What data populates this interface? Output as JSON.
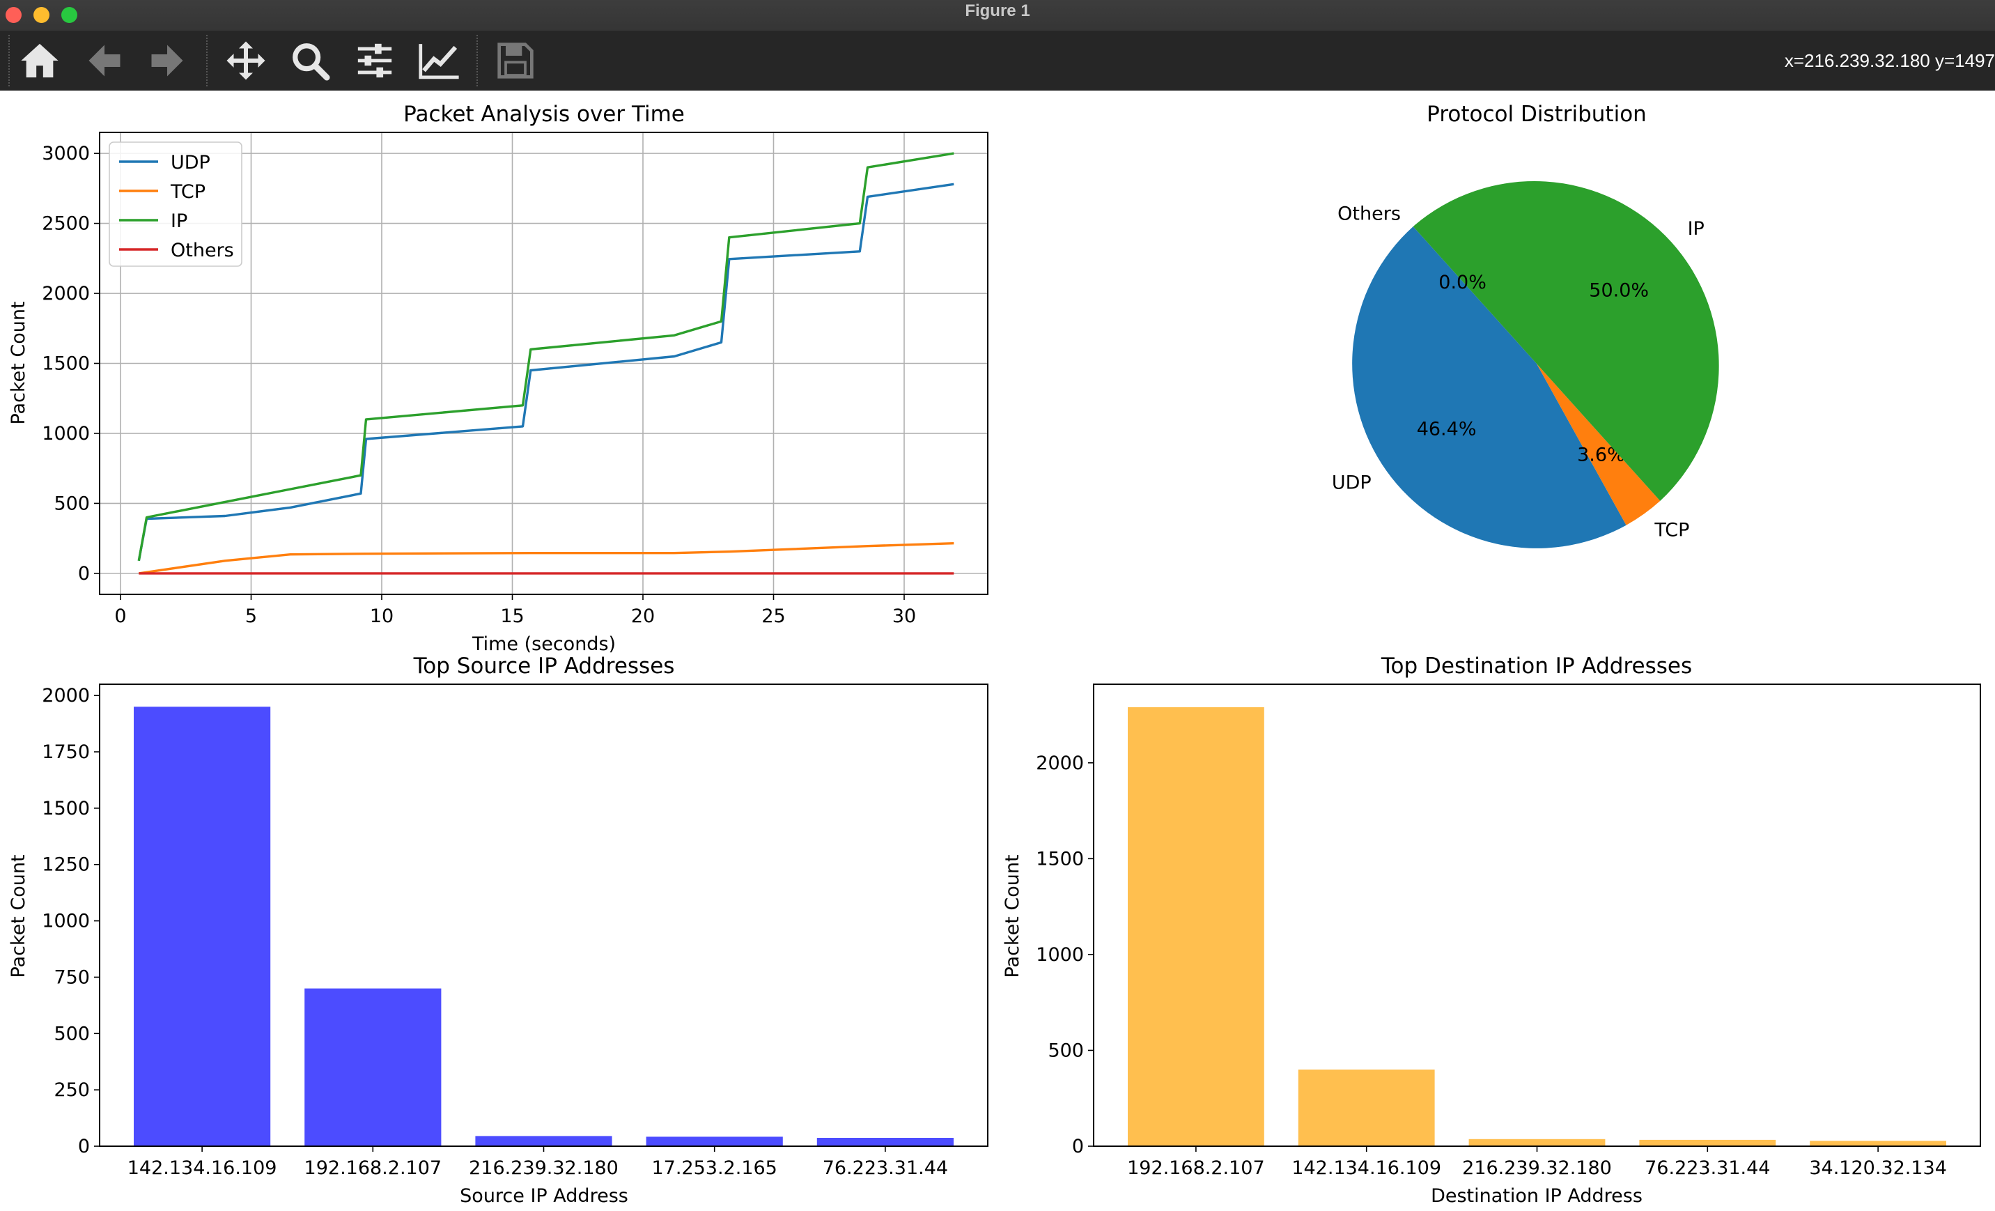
{
  "window": {
    "title": "Figure 1",
    "buttons": [
      "close",
      "minimize",
      "zoom"
    ],
    "button_colors": {
      "close": "#ff5f57",
      "minimize": "#febc2e",
      "zoom": "#28c840"
    }
  },
  "toolbar": {
    "tools": [
      {
        "name": "home",
        "icon": "home-icon"
      },
      {
        "name": "back",
        "icon": "arrow-left-icon"
      },
      {
        "name": "forward",
        "icon": "arrow-right-icon"
      },
      {
        "name": "pan",
        "icon": "move-icon"
      },
      {
        "name": "zoom",
        "icon": "magnifier-icon"
      },
      {
        "name": "configure-subplots",
        "icon": "sliders-icon"
      },
      {
        "name": "edit-axis",
        "icon": "line-chart-icon"
      },
      {
        "name": "save",
        "icon": "floppy-disk-icon"
      }
    ],
    "coords_text": "x=216.239.32.180 y=1497"
  },
  "chart_data": [
    {
      "type": "line",
      "title": "Packet Analysis over Time",
      "xlabel": "Time (seconds)",
      "ylabel": "Packet Count",
      "xlim": [
        -0.8,
        33.2
      ],
      "ylim": [
        -150,
        3150
      ],
      "xticks": [
        0,
        5,
        10,
        15,
        20,
        25,
        30
      ],
      "yticks": [
        0,
        500,
        1000,
        1500,
        2000,
        2500,
        3000
      ],
      "grid": true,
      "legend_position": "upper left",
      "series": [
        {
          "name": "UDP",
          "color": "#1f77b4",
          "x": [
            0.7,
            1.0,
            4.0,
            6.5,
            9.2,
            9.4,
            15.4,
            15.7,
            21.2,
            23.0,
            23.3,
            28.3,
            28.6,
            31.9
          ],
          "y": [
            90,
            390,
            410,
            470,
            570,
            960,
            1050,
            1450,
            1550,
            1650,
            2245,
            2300,
            2690,
            2780
          ]
        },
        {
          "name": "TCP",
          "color": "#ff7f0e",
          "x": [
            0.7,
            4.0,
            6.5,
            9.4,
            15.7,
            21.2,
            23.3,
            28.6,
            31.9
          ],
          "y": [
            0,
            90,
            135,
            140,
            145,
            145,
            155,
            195,
            215
          ]
        },
        {
          "name": "IP",
          "color": "#2ca02c",
          "x": [
            0.7,
            1.0,
            9.2,
            9.4,
            15.4,
            15.7,
            21.2,
            23.0,
            23.3,
            28.3,
            28.6,
            31.9
          ],
          "y": [
            90,
            400,
            700,
            1100,
            1200,
            1600,
            1700,
            1800,
            2400,
            2500,
            2900,
            3000
          ]
        },
        {
          "name": "Others",
          "color": "#d62728",
          "x": [
            0.7,
            31.9
          ],
          "y": [
            0,
            0
          ]
        }
      ]
    },
    {
      "type": "pie",
      "title": "Protocol Distribution",
      "slices": [
        {
          "label": "UDP",
          "value": 46.4,
          "pct_label": "46.4%",
          "color": "#1f77b4"
        },
        {
          "label": "TCP",
          "value": 3.6,
          "pct_label": "3.6%",
          "color": "#ff7f0e"
        },
        {
          "label": "IP",
          "value": 50.0,
          "pct_label": "50.0%",
          "color": "#2ca02c"
        },
        {
          "label": "Others",
          "value": 0.0,
          "pct_label": "0.0%",
          "color": "#d62728"
        }
      ]
    },
    {
      "type": "bar",
      "title": "Top Source IP Addresses",
      "xlabel": "Source IP Address",
      "ylabel": "Packet Count",
      "color": "#4c4cff",
      "categories": [
        "142.134.16.109",
        "192.168.2.107",
        "216.239.32.180",
        "17.253.2.165",
        "76.223.31.44"
      ],
      "values": [
        1950,
        700,
        45,
        42,
        37
      ],
      "ylim": [
        0,
        2050
      ],
      "yticks": [
        0,
        250,
        500,
        750,
        1000,
        1250,
        1500,
        1750,
        2000
      ]
    },
    {
      "type": "bar",
      "title": "Top Destination IP Addresses",
      "xlabel": "Destination IP Address",
      "ylabel": "Packet Count",
      "color": "#ffbf4f",
      "categories": [
        "192.168.2.107",
        "142.134.16.109",
        "216.239.32.180",
        "76.223.31.44",
        "34.120.32.134"
      ],
      "values": [
        2290,
        400,
        37,
        33,
        28
      ],
      "ylim": [
        0,
        2410
      ],
      "yticks": [
        0,
        500,
        1000,
        1500,
        2000
      ]
    }
  ]
}
